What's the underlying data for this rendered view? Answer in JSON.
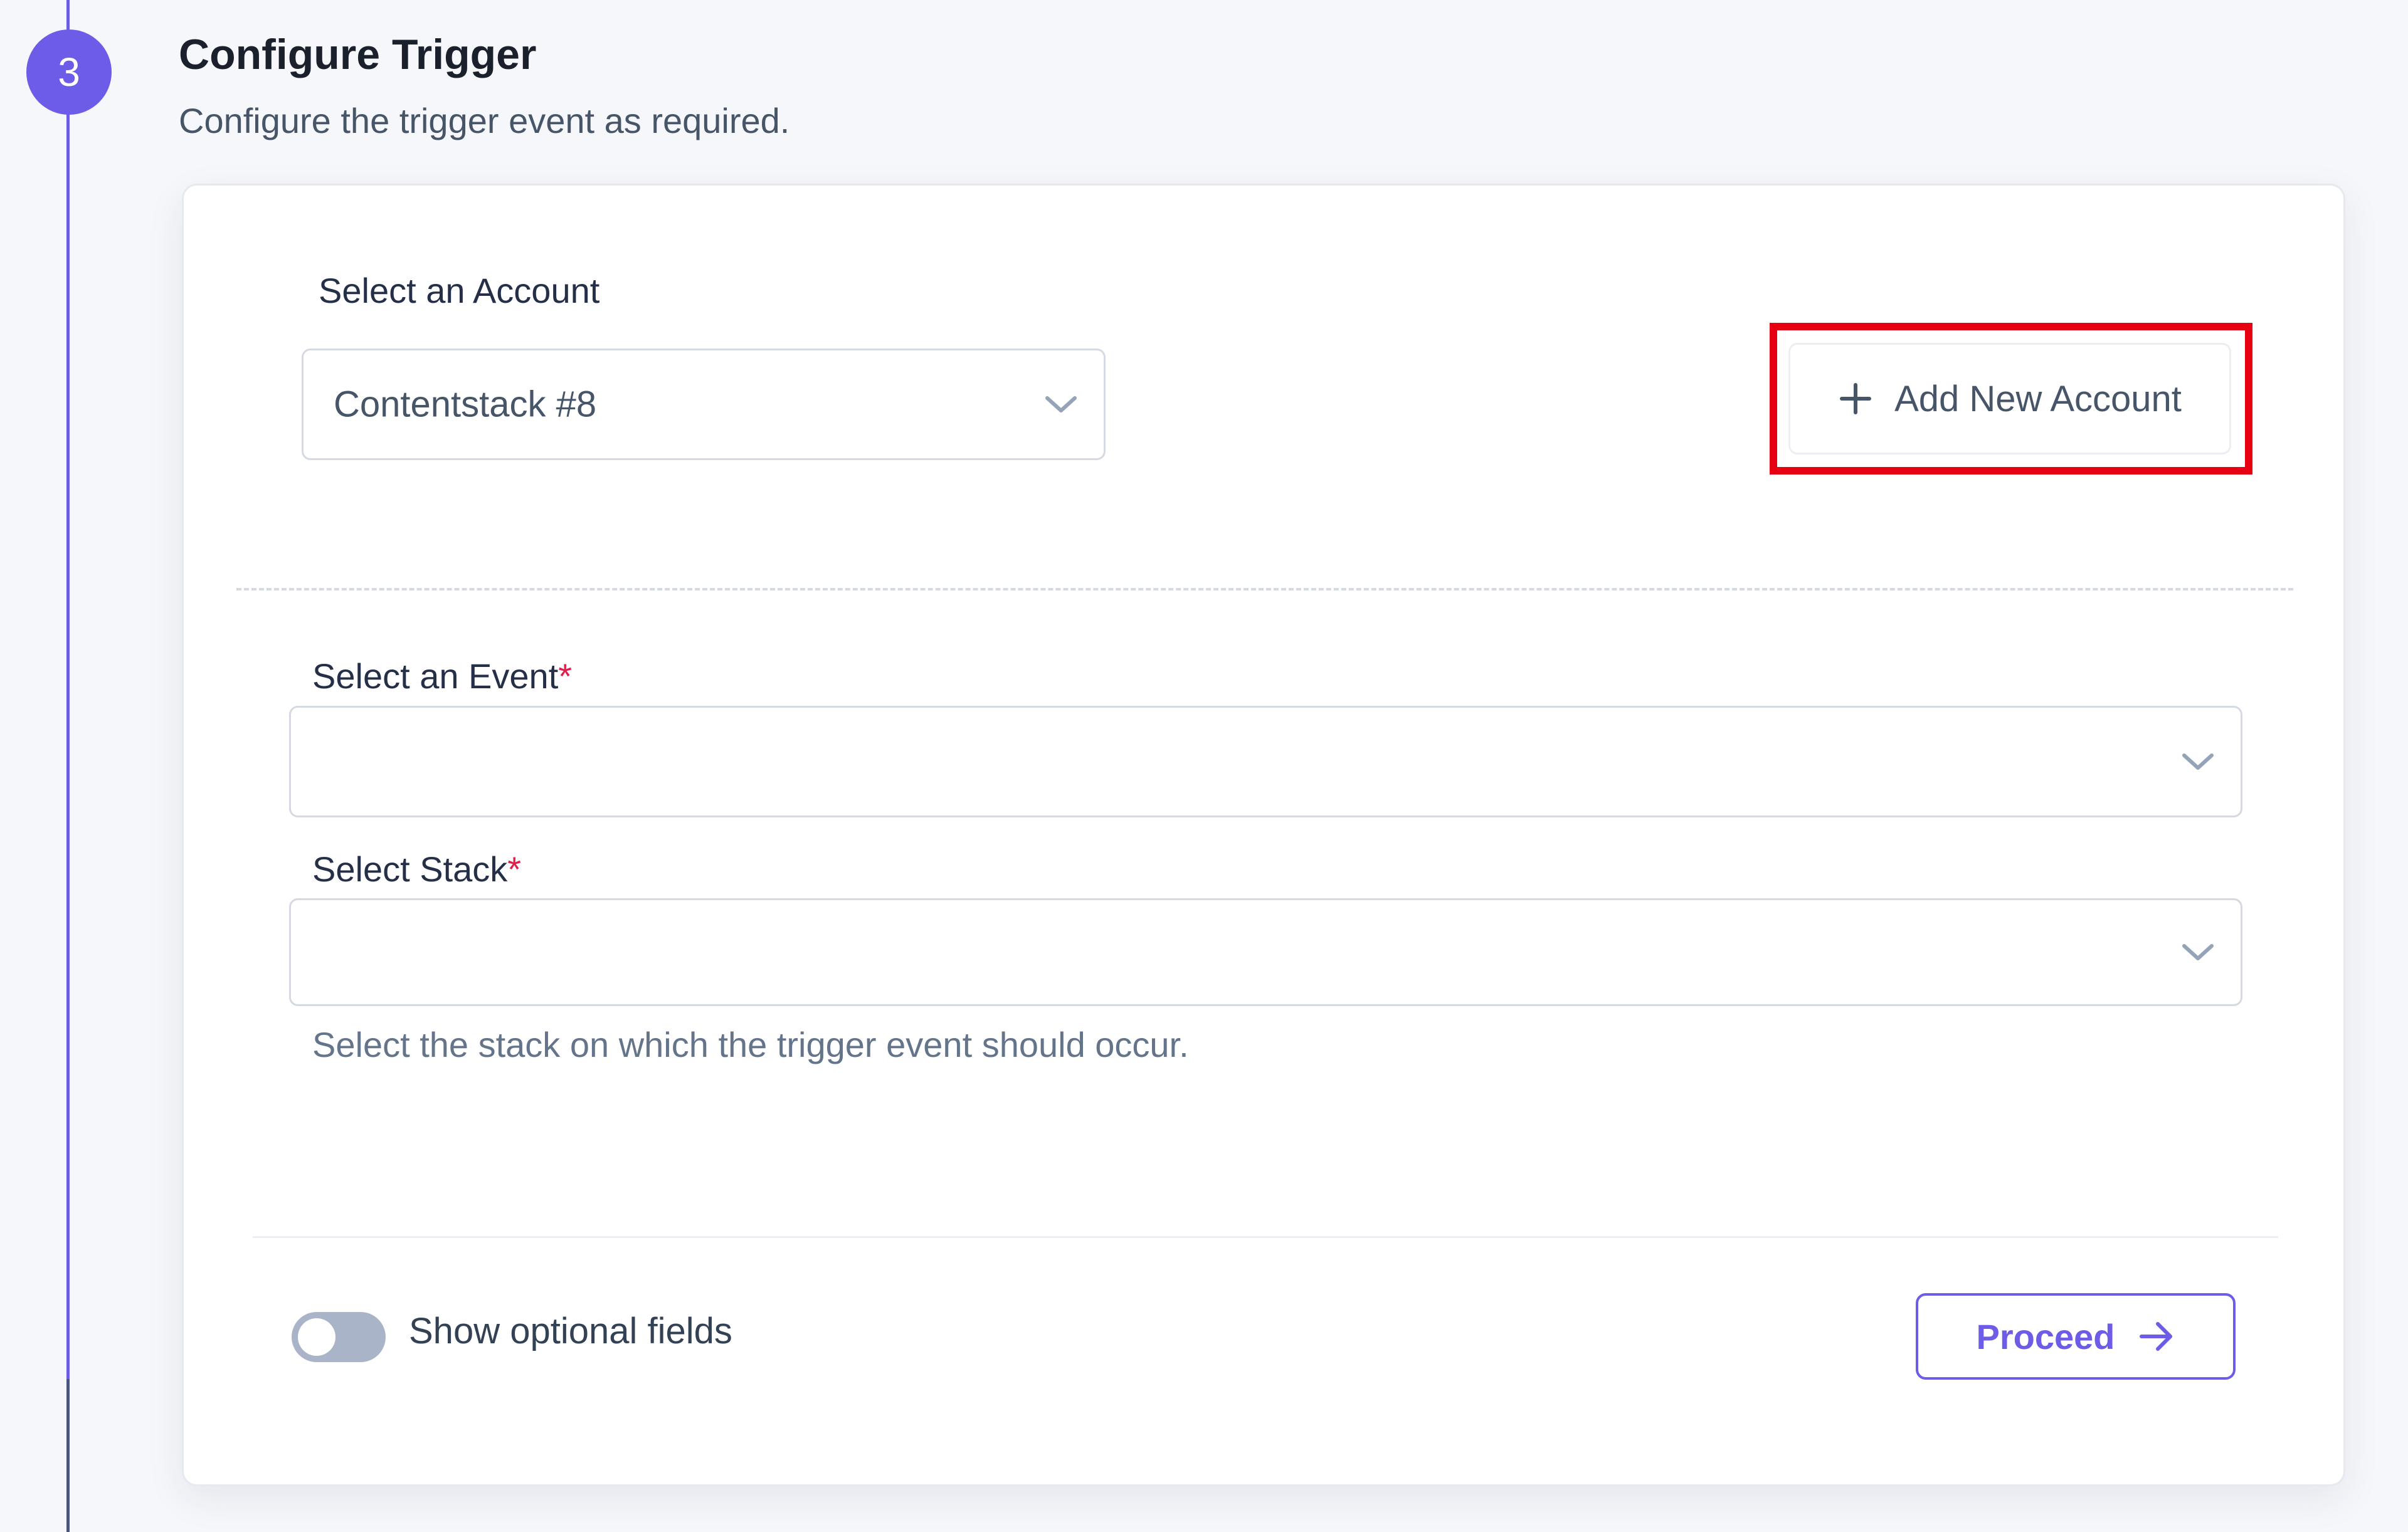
{
  "step": {
    "number": "3",
    "title": "Configure Trigger",
    "description": "Configure the trigger event as required."
  },
  "account": {
    "label": "Select an Account",
    "selected": "Contentstack #8",
    "add_button_label": "Add New Account"
  },
  "event": {
    "label": "Select an Event",
    "required_mark": "*",
    "selected": ""
  },
  "stack": {
    "label": "Select Stack",
    "required_mark": "*",
    "selected": "",
    "help_text": "Select the stack on which the trigger event should occur."
  },
  "footer": {
    "toggle_label": "Show optional fields",
    "toggle_on": false,
    "proceed_label": "Proceed"
  },
  "colors": {
    "accent": "#6c5ce7",
    "highlight": "#e60012",
    "required": "#e11d48"
  },
  "icons": {
    "dropdown": "chevron-down-icon",
    "add": "plus-icon",
    "proceed": "arrow-right-icon"
  }
}
